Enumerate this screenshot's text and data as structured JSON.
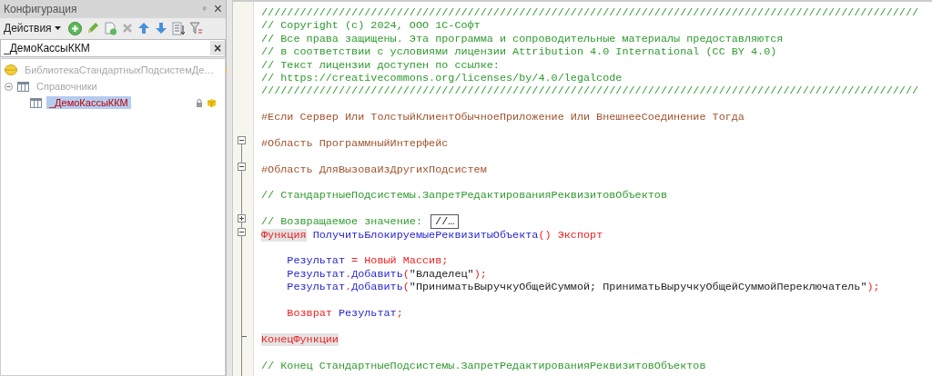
{
  "panel": {
    "title": "Конфигурация",
    "pin": "ᵠ",
    "close": "×",
    "actions_label": "Действия",
    "search": {
      "value": "_ДемоКассыККМ",
      "clear": "×"
    },
    "tree": [
      {
        "label": "БиблиотекаСтандартныхПодсистемДе…",
        "kind": "subsystem",
        "disabled": true,
        "highlighted": false,
        "selected": false,
        "supported": true,
        "locked": false
      },
      {
        "label": "Справочники",
        "kind": "folder",
        "disabled": true,
        "highlighted": false,
        "selected": false,
        "supported": false,
        "locked": false,
        "expanded": true,
        "children": [
          {
            "label": "_ДемоКассыККМ",
            "kind": "catalog",
            "disabled": false,
            "highlighted": true,
            "selected": true,
            "supported": true,
            "locked": true
          }
        ]
      }
    ]
  },
  "editor": {
    "lines": [
      {
        "kind": "code",
        "tokens": [
          {
            "kind": "comment",
            "text": "//////////////////////////////////////////////////////////////////////////////////////////////////////"
          }
        ]
      },
      {
        "kind": "code",
        "tokens": [
          {
            "kind": "comment",
            "text": "// Copyright (c) 2024, ООО 1С-Софт"
          }
        ]
      },
      {
        "kind": "code",
        "tokens": [
          {
            "kind": "comment",
            "text": "// Все права защищены. Эта программа и сопроводительные материалы предоставляются"
          }
        ]
      },
      {
        "kind": "code",
        "tokens": [
          {
            "kind": "comment",
            "text": "// в соответствии с условиями лицензии Attribution 4.0 International (CC BY 4.0)"
          }
        ]
      },
      {
        "kind": "code",
        "tokens": [
          {
            "kind": "comment",
            "text": "// Текст лицензии доступен по ссылке:"
          }
        ]
      },
      {
        "kind": "code",
        "tokens": [
          {
            "kind": "comment",
            "text": "// https://creativecommons.org/licenses/by/4.0/legalcode"
          }
        ]
      },
      {
        "kind": "code",
        "tokens": [
          {
            "kind": "comment",
            "text": "//////////////////////////////////////////////////////////////////////////////////////////////////////"
          }
        ]
      },
      {
        "kind": "blank"
      },
      {
        "kind": "code",
        "tokens": [
          {
            "kind": "preproc",
            "text": "#Если Сервер Или ТолстыйКлиентОбычноеПриложение Или ВнешнееСоединение Тогда"
          }
        ]
      },
      {
        "kind": "blank"
      },
      {
        "kind": "code",
        "fold_expanded": true,
        "tokens": [
          {
            "kind": "preproc",
            "text": "#Область ПрограммныйИнтерфейс"
          }
        ]
      },
      {
        "kind": "blank"
      },
      {
        "kind": "code",
        "fold_expanded": true,
        "tokens": [
          {
            "kind": "preproc",
            "text": "#Область ДляВызоваИзДругихПодсистем"
          }
        ]
      },
      {
        "kind": "blank"
      },
      {
        "kind": "code",
        "tokens": [
          {
            "kind": "comment",
            "text": "// СтандартныеПодсистемы.ЗапретРедактированияРеквизитовОбъектов"
          }
        ]
      },
      {
        "kind": "blank"
      },
      {
        "kind": "code",
        "fold_expanded": false,
        "tokens": [
          {
            "kind": "comment",
            "text": "// Возвращаемое значение: "
          },
          {
            "kind": "collapsed",
            "text": "//…"
          }
        ]
      },
      {
        "kind": "code",
        "fold_expanded": true,
        "tokens": [
          {
            "kind": "keyword",
            "text": "Функция",
            "highlighted": true
          },
          {
            "kind": "ident",
            "text": " ПолучитьБлокируемыеРеквизитыОбъекта"
          },
          {
            "kind": "punct",
            "text": "()"
          },
          {
            "kind": "keyword",
            "text": " Экспорт"
          }
        ]
      },
      {
        "kind": "blank"
      },
      {
        "kind": "code",
        "tokens": [
          {
            "kind": "ident",
            "text": "    Результат"
          },
          {
            "kind": "punct",
            "text": " = "
          },
          {
            "kind": "keyword",
            "text": "Новый Массив"
          },
          {
            "kind": "punct",
            "text": ";"
          }
        ]
      },
      {
        "kind": "code",
        "tokens": [
          {
            "kind": "ident",
            "text": "    Результат"
          },
          {
            "kind": "punct",
            "text": "."
          },
          {
            "kind": "ident",
            "text": "Добавить"
          },
          {
            "kind": "punct",
            "text": "("
          },
          {
            "kind": "string",
            "text": "\"Владелец\""
          },
          {
            "kind": "punct",
            "text": ");"
          }
        ]
      },
      {
        "kind": "code",
        "tokens": [
          {
            "kind": "ident",
            "text": "    Результат"
          },
          {
            "kind": "punct",
            "text": "."
          },
          {
            "kind": "ident",
            "text": "Добавить"
          },
          {
            "kind": "punct",
            "text": "("
          },
          {
            "kind": "string",
            "text": "\"ПриниматьВыручкуОбщейСуммой; ПриниматьВыручкуОбщейСуммойПереключатель\""
          },
          {
            "kind": "punct",
            "text": ");"
          }
        ]
      },
      {
        "kind": "blank"
      },
      {
        "kind": "code",
        "tokens": [
          {
            "kind": "keyword",
            "text": "    Возврат"
          },
          {
            "kind": "ident",
            "text": " Результат"
          },
          {
            "kind": "punct",
            "text": ";"
          }
        ]
      },
      {
        "kind": "blank"
      },
      {
        "kind": "code",
        "block_end": true,
        "tokens": [
          {
            "kind": "keyword",
            "text": "КонецФункции",
            "highlighted": true
          }
        ]
      },
      {
        "kind": "blank"
      },
      {
        "kind": "code",
        "tokens": [
          {
            "kind": "comment",
            "text": "// Конец СтандартныеПодсистемы.ЗапретРедактированияРеквизитовОбъектов"
          }
        ]
      }
    ]
  }
}
